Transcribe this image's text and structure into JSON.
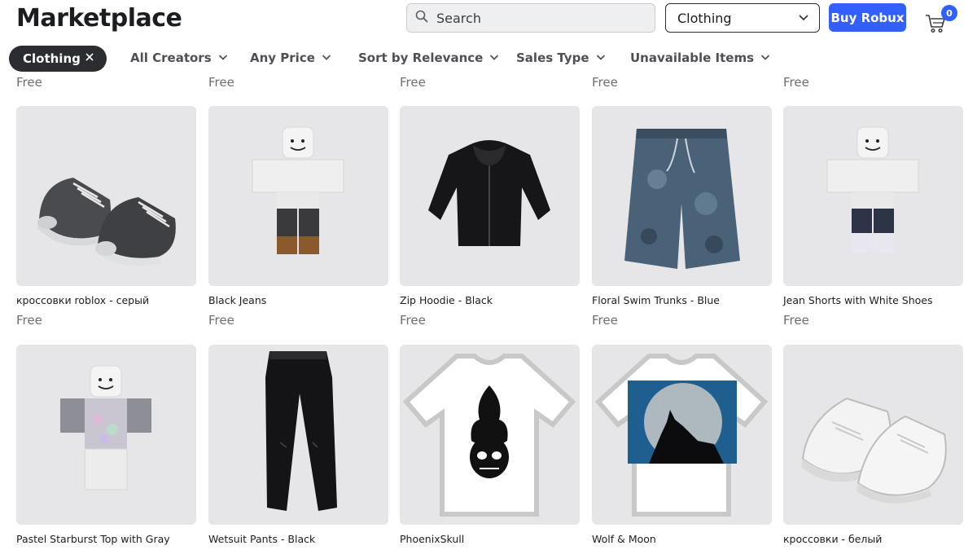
{
  "header": {
    "title": "Marketplace",
    "search_placeholder": "Search",
    "category": "Clothing",
    "buy_robux": "Buy Robux",
    "cart_count": "0",
    "accent_color": "#335fff"
  },
  "filters": {
    "active_chip": "Clothing",
    "items": [
      {
        "label": "All Creators"
      },
      {
        "label": "Any Price"
      },
      {
        "label": "Sort by Relevance"
      },
      {
        "label": "Sales Type"
      },
      {
        "label": "Unavailable Items"
      }
    ]
  },
  "previous_row_prices": [
    "Free",
    "Free",
    "Free",
    "Free",
    "Free"
  ],
  "items": [
    {
      "name": "кроссовки roblox - серый",
      "price": "Free",
      "icon": "gray-sneakers-icon"
    },
    {
      "name": "Black Jeans",
      "price": "Free",
      "icon": "avatar-black-jeans-icon"
    },
    {
      "name": "Zip Hoodie - Black",
      "price": "Free",
      "icon": "black-hoodie-icon"
    },
    {
      "name": "Floral Swim Trunks - Blue",
      "price": "Free",
      "icon": "swim-trunks-icon"
    },
    {
      "name": "Jean Shorts with White Shoes",
      "price": "Free",
      "icon": "avatar-jean-shorts-icon"
    },
    {
      "name": "Pastel Starburst Top with Gray",
      "price": "",
      "icon": "avatar-pastel-top-icon"
    },
    {
      "name": "Wetsuit Pants - Black",
      "price": "",
      "icon": "black-pants-icon"
    },
    {
      "name": "PhoenixSkull",
      "price": "",
      "icon": "phoenix-skull-tshirt-icon"
    },
    {
      "name": "Wolf & Moon",
      "price": "",
      "icon": "wolf-moon-tshirt-icon"
    },
    {
      "name": "кроссовки - белый",
      "price": "",
      "icon": "white-sneakers-icon"
    }
  ]
}
